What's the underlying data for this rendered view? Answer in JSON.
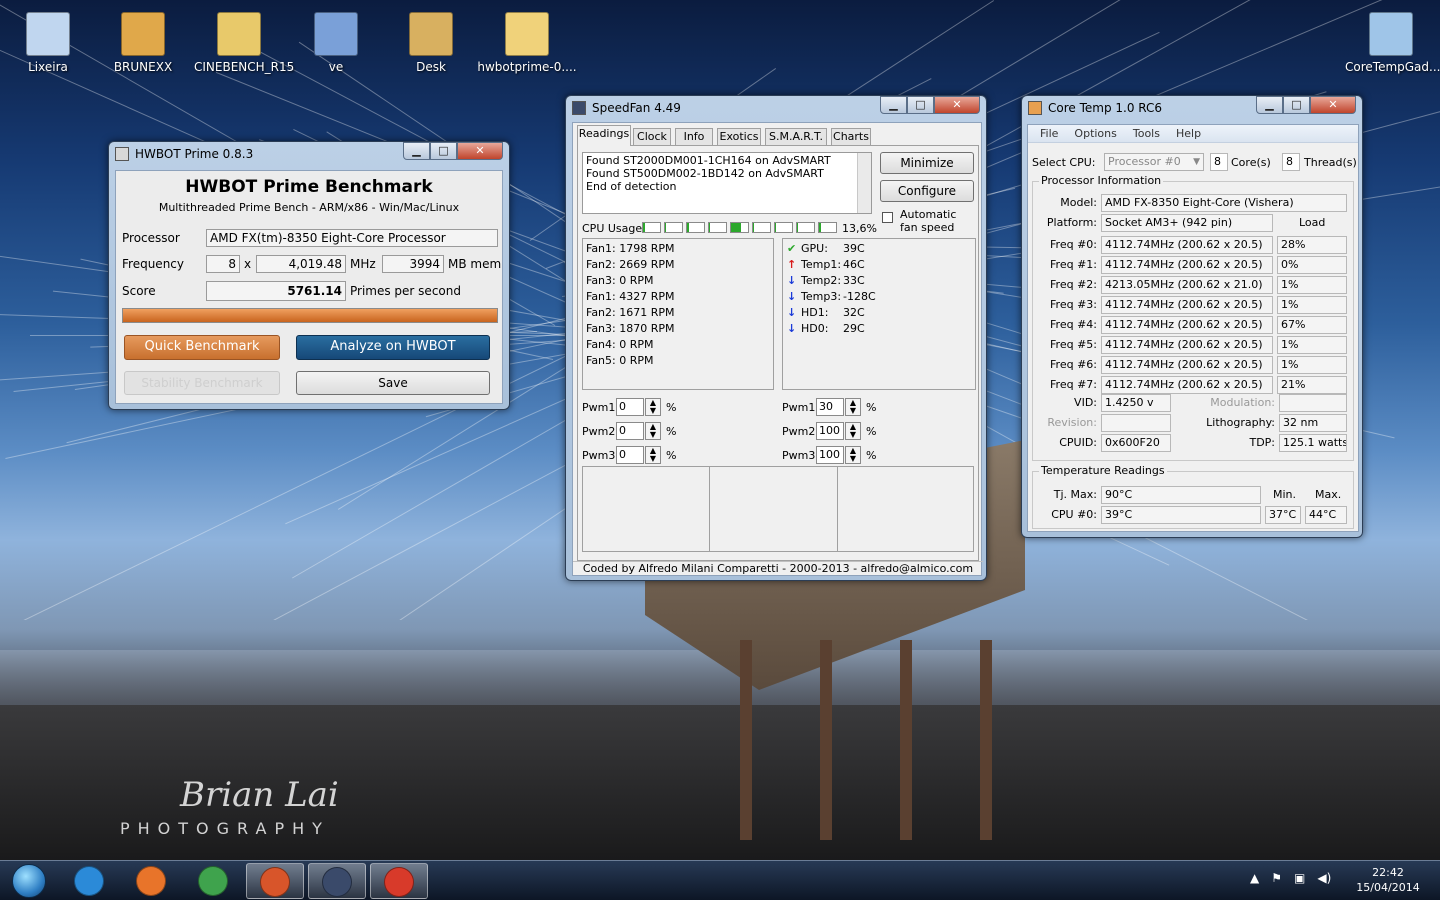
{
  "desktop": {
    "icons": [
      {
        "label": "Lixeira",
        "icon": "recycle-bin-icon",
        "color": "#c0d6ef"
      },
      {
        "label": "BRUNEXX",
        "icon": "folder-icon",
        "color": "#e0a84a"
      },
      {
        "label": "CINEBENCH_R15",
        "icon": "folder-icon",
        "color": "#e8c96a"
      },
      {
        "label": "ve",
        "icon": "shortcut-icon",
        "color": "#7aa0d8"
      },
      {
        "label": "Desk",
        "icon": "folder-icon",
        "color": "#d8b060"
      },
      {
        "label": "hwbotprime-0....",
        "icon": "folder-icon",
        "color": "#f0d27a"
      },
      {
        "label": "CoreTempGad...",
        "icon": "gadget-icon",
        "color": "#9fc5e8"
      }
    ],
    "watermark": {
      "line1": "Brian Lai",
      "line2": "PHOTOGRAPHY"
    }
  },
  "hwbot": {
    "title": "HWBOT Prime 0.8.3",
    "heading": "HWBOT Prime Benchmark",
    "subheading": "Multithreaded Prime Bench - ARM/x86 - Win/Mac/Linux",
    "processor_label": "Processor",
    "processor_value": "AMD FX(tm)-8350 Eight-Core Processor",
    "frequency_label": "Frequency",
    "freq_mult": "8",
    "freq_x": "x",
    "freq_value": "4,019.48",
    "freq_unit": "MHz",
    "mem_value": "3994",
    "mem_unit": "MB mem",
    "score_label": "Score",
    "score_value": "5761.14",
    "score_unit": "Primes per second",
    "progress": 1.0,
    "quick_label": "Quick Benchmark",
    "analyze_label": "Analyze on HWBOT",
    "stability_label": "Stability Benchmark",
    "save_label": "Save"
  },
  "speedfan": {
    "title": "SpeedFan 4.49",
    "tabs": [
      "Readings",
      "Clock",
      "Info",
      "Exotics",
      "S.M.A.R.T.",
      "Charts"
    ],
    "log": [
      "Found ST2000DM001-1CH164 on AdvSMART",
      "Found ST500DM002-1BD142 on AdvSMART",
      "End of detection"
    ],
    "minimize_label": "Minimize",
    "configure_label": "Configure",
    "autofan_label": "Automatic fan speed",
    "cpu_usage_label": "CPU Usage",
    "cpu_usage_value": "13,6%",
    "cpu_bars": [
      0.1,
      0.0,
      0.1,
      0.0,
      0.6,
      0.0,
      0.0,
      0.0,
      0.1
    ],
    "fans": [
      "Fan1: 1798 RPM",
      "Fan2: 2669 RPM",
      "Fan3: 0 RPM",
      "Fan1: 4327 RPM",
      "Fan2: 1671 RPM",
      "Fan3: 1870 RPM",
      "Fan4: 0 RPM",
      "Fan5: 0 RPM"
    ],
    "temps": [
      {
        "name": "GPU:",
        "value": "39C",
        "trend": "ok"
      },
      {
        "name": "Temp1:",
        "value": "46C",
        "trend": "up"
      },
      {
        "name": "Temp2:",
        "value": "33C",
        "trend": "down"
      },
      {
        "name": "Temp3:",
        "value": "-128C",
        "trend": "down"
      },
      {
        "name": "HD1:",
        "value": "32C",
        "trend": "down"
      },
      {
        "name": "HD0:",
        "value": "29C",
        "trend": "down"
      }
    ],
    "pwm_left": [
      {
        "label": "Pwm1:",
        "value": "0"
      },
      {
        "label": "Pwm2:",
        "value": "0"
      },
      {
        "label": "Pwm3:",
        "value": "0"
      }
    ],
    "pwm_right": [
      {
        "label": "Pwm1:",
        "value": "30"
      },
      {
        "label": "Pwm2:",
        "value": "100"
      },
      {
        "label": "Pwm3:",
        "value": "100"
      }
    ],
    "pct": "%",
    "footer": "Coded by Alfredo Milani Comparetti - 2000-2013 - alfredo@almico.com"
  },
  "coretemp": {
    "title": "Core Temp 1.0 RC6",
    "menu": [
      "File",
      "Options",
      "Tools",
      "Help"
    ],
    "select_cpu_label": "Select CPU:",
    "select_cpu_value": "Processor #0",
    "cores_value": "8",
    "cores_label": "Core(s)",
    "threads_value": "8",
    "threads_label": "Thread(s)",
    "proc_info_label": "Processor Information",
    "model_label": "Model:",
    "model_value": "AMD FX-8350 Eight-Core (Vishera)",
    "platform_label": "Platform:",
    "platform_value": "Socket AM3+ (942 pin)",
    "load_label": "Load",
    "freqs": [
      {
        "label": "Freq #0:",
        "value": "4112.74MHz (200.62 x 20.5)",
        "load": "28%"
      },
      {
        "label": "Freq #1:",
        "value": "4112.74MHz (200.62 x 20.5)",
        "load": "0%"
      },
      {
        "label": "Freq #2:",
        "value": "4213.05MHz (200.62 x 21.0)",
        "load": "1%"
      },
      {
        "label": "Freq #3:",
        "value": "4112.74MHz (200.62 x 20.5)",
        "load": "1%"
      },
      {
        "label": "Freq #4:",
        "value": "4112.74MHz (200.62 x 20.5)",
        "load": "67%"
      },
      {
        "label": "Freq #5:",
        "value": "4112.74MHz (200.62 x 20.5)",
        "load": "1%"
      },
      {
        "label": "Freq #6:",
        "value": "4112.74MHz (200.62 x 20.5)",
        "load": "1%"
      },
      {
        "label": "Freq #7:",
        "value": "4112.74MHz (200.62 x 20.5)",
        "load": "21%"
      }
    ],
    "vid_label": "VID:",
    "vid_value": "1.4250 v",
    "modulation_label": "Modulation:",
    "revision_label": "Revision:",
    "lithography_label": "Lithography:",
    "lithography_value": "32 nm",
    "cpuid_label": "CPUID:",
    "cpuid_value": "0x600F20",
    "tdp_label": "TDP:",
    "tdp_value": "125.1 watts",
    "temp_label": "Temperature Readings",
    "tjmax_label": "Tj. Max:",
    "tjmax_value": "90°C",
    "min_label": "Min.",
    "max_label": "Max.",
    "cpu0_label": "CPU #0:",
    "cpu0_value": "39°C",
    "cpu0_min": "37°C",
    "cpu0_max": "44°C"
  },
  "taskbar": {
    "apps": [
      {
        "name": "internet-explorer",
        "icon": "ie-icon",
        "color": "#2b8ad8"
      },
      {
        "name": "firefox",
        "icon": "firefox-icon",
        "color": "#e8742a"
      },
      {
        "name": "chrome",
        "icon": "chrome-icon",
        "color": "#3fa34d"
      },
      {
        "name": "java",
        "icon": "java-icon",
        "color": "#d8552a"
      },
      {
        "name": "speedfan",
        "icon": "fan-icon",
        "color": "#3a4a6a"
      },
      {
        "name": "coretemp",
        "icon": "thermometer-icon",
        "color": "#d83a2a"
      }
    ],
    "time": "22:42",
    "date": "15/04/2014"
  },
  "colors": {
    "hwbot_orange": "#d47a3a",
    "hwbot_blue": "#1f5a8a",
    "speedfan_green": "#2ca82c",
    "speedfan_red": "#d81a1a",
    "speedfan_blue": "#1a3ad8"
  }
}
